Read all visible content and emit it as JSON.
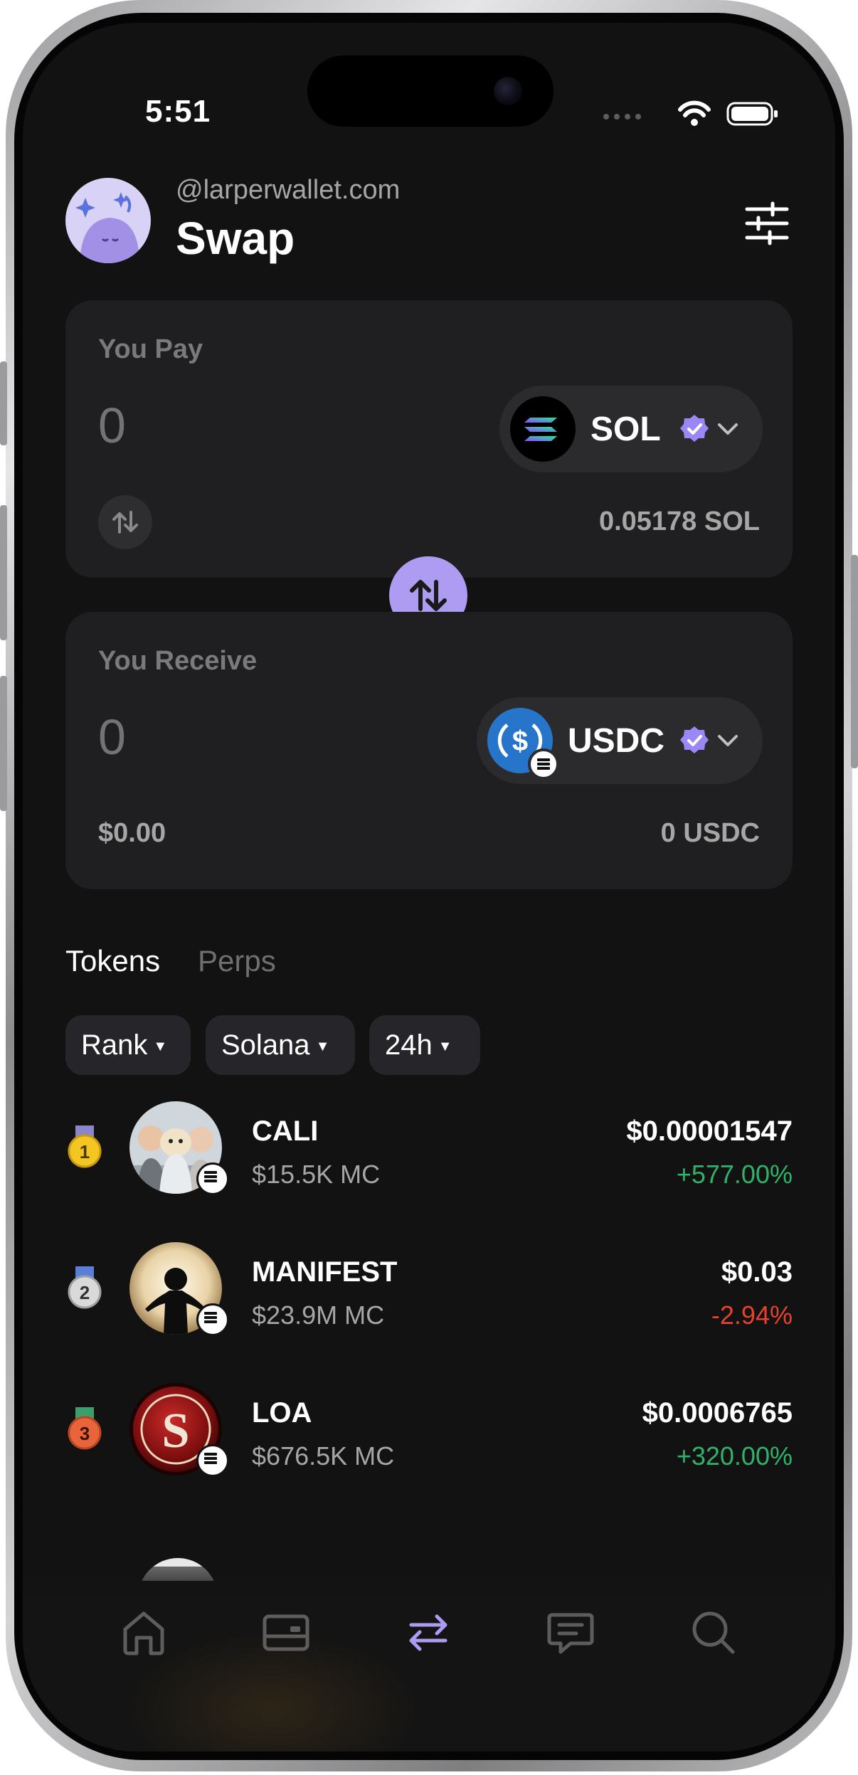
{
  "status_bar": {
    "time": "5:51"
  },
  "header": {
    "handle": "@larperwallet.com",
    "title": "Swap"
  },
  "pay": {
    "label": "You Pay",
    "amount": "0",
    "token": "SOL",
    "balance": "0.05178 SOL"
  },
  "receive": {
    "label": "You Receive",
    "amount": "0",
    "token": "USDC",
    "usd_value": "$0.00",
    "balance": "0 USDC"
  },
  "tabs": [
    {
      "label": "Tokens",
      "active": true
    },
    {
      "label": "Perps",
      "active": false
    }
  ],
  "filters": [
    {
      "label": "Rank"
    },
    {
      "label": "Solana"
    },
    {
      "label": "24h"
    }
  ],
  "tokens": [
    {
      "rank": "1",
      "name": "CALI",
      "market_cap": "$15.5K MC",
      "price": "$0.00001547",
      "change": "+577.00%"
    },
    {
      "rank": "2",
      "name": "MANIFEST",
      "market_cap": "$23.9M MC",
      "price": "$0.03",
      "change": "-2.94%"
    },
    {
      "rank": "3",
      "name": "LOA",
      "market_cap": "$676.5K MC",
      "price": "$0.0006765",
      "change": "+320.00%"
    }
  ],
  "nav": [
    {
      "icon": "home-icon"
    },
    {
      "icon": "wallet-card-icon"
    },
    {
      "icon": "swap-arrows-icon",
      "active": true
    },
    {
      "icon": "chat-icon"
    },
    {
      "icon": "search-icon"
    }
  ],
  "colors": {
    "background": "#121212",
    "card": "#1f1f21",
    "accent": "#ad9cf2",
    "positive": "#2fb36b",
    "negative": "#e5432c"
  }
}
